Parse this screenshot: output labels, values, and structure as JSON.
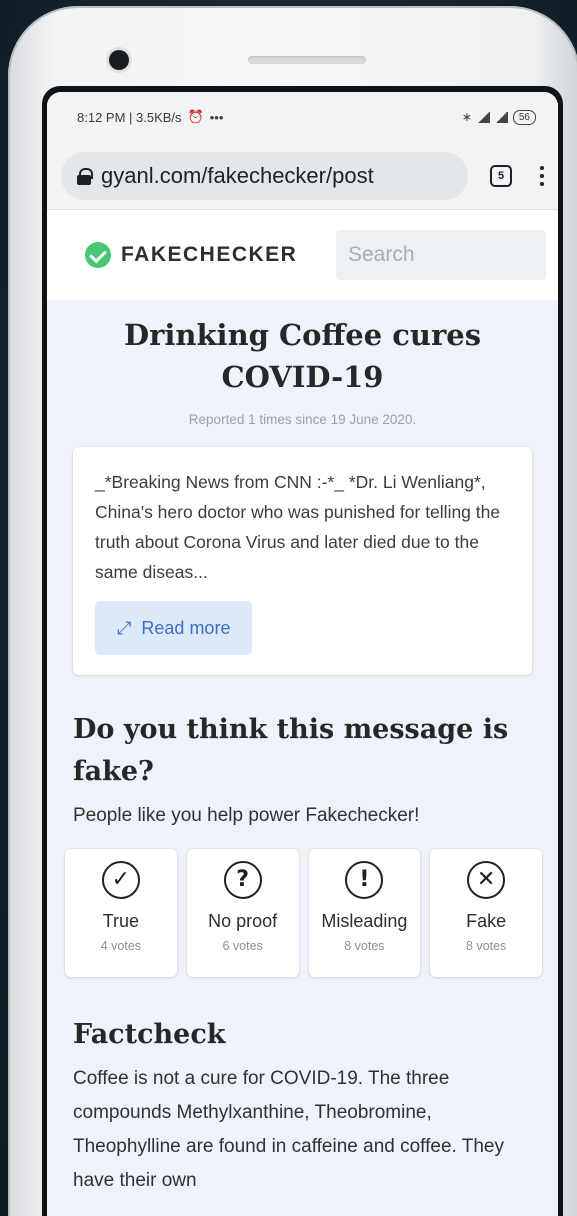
{
  "status_bar": {
    "time": "8:12 PM | 3.5KB/s",
    "alarm_icon": "alarm-icon",
    "more": "•••",
    "battery": "56"
  },
  "browser": {
    "url": "gyanl.com/fakechecker/post",
    "tab_count": "5"
  },
  "site": {
    "brand": "FAKECHECKER",
    "brand_color": "#48c774",
    "search_placeholder": "Search"
  },
  "post": {
    "title": "Drinking Coffee cures COVID-19",
    "reported": "Reported 1 times since 19 June 2020.",
    "message": "_*Breaking News from CNN :-*_ *Dr. Li Wenliang*, China's hero doctor who was punished for telling the truth about Corona Virus and later died due to the same diseas...",
    "read_more_label": "Read more",
    "accent_color": "#3e6fc5"
  },
  "vote": {
    "heading": "Do you think this message is fake?",
    "subheading": "People like you help power Fakechecker!",
    "options": [
      {
        "label": "True",
        "count": "4 votes",
        "icon": "check-circle-icon",
        "glyph": "✓"
      },
      {
        "label": "No proof",
        "count": "6 votes",
        "icon": "question-circle-icon",
        "glyph": "?"
      },
      {
        "label": "Misleading",
        "count": "8 votes",
        "icon": "exclamation-circle-icon",
        "glyph": "!"
      },
      {
        "label": "Fake",
        "count": "8 votes",
        "icon": "x-circle-icon",
        "glyph": "✕"
      }
    ]
  },
  "factcheck": {
    "heading": "Factcheck",
    "text": "Coffee is not a cure for COVID-19. The three compounds Methylxanthine, Theobromine, Theophylline are found in caffeine and coffee. They have their own"
  }
}
